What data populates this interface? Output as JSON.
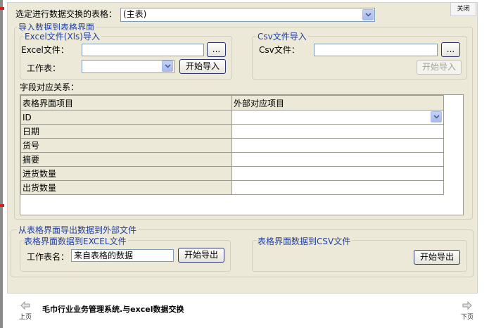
{
  "close_label": "关闭",
  "top": {
    "label": "选定进行数据交换的表格：",
    "select_value": "(主表)"
  },
  "import": {
    "title": "导入数据到表格界面",
    "excel": {
      "title": "Excel文件(Xls)导入",
      "file_label": "Excel文件：",
      "file_value": "",
      "browse_label": "...",
      "sheet_label": "工作表：",
      "sheet_value": "",
      "import_button": "开始导入"
    },
    "csv": {
      "title": "Csv文件导入",
      "file_label": "Csv文件：",
      "file_value": "",
      "browse_label": "...",
      "import_button": "开始导入"
    },
    "mapping_label": "字段对应关系：",
    "mapping_headers": [
      "表格界面项目",
      "外部对应项目"
    ],
    "mapping_rows": [
      {
        "field": "ID",
        "external": ""
      },
      {
        "field": "日期",
        "external": ""
      },
      {
        "field": "货号",
        "external": ""
      },
      {
        "field": "摘要",
        "external": ""
      },
      {
        "field": "进货数量",
        "external": ""
      },
      {
        "field": "出货数量",
        "external": ""
      }
    ]
  },
  "export": {
    "title": "从表格界面导出数据到外部文件",
    "excel": {
      "title": "表格界面数据到EXCEL文件",
      "sheet_label": "工作表名：",
      "sheet_value": "来自表格的数据",
      "export_button": "开始导出"
    },
    "csv": {
      "title": "表格界面数据到CSV文件",
      "export_button": "开始导出"
    }
  },
  "footer": {
    "prev_label": "上页",
    "title": "毛巾行业业务管理系统.与excel数据交换",
    "next_label": "下页"
  },
  "colors": {
    "accent_blue": "#1f3f9f",
    "dialog_bg": "#ece9d8",
    "border": "#7f9db9"
  }
}
